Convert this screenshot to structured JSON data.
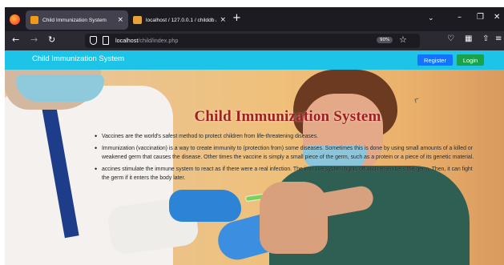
{
  "browser": {
    "tabs": [
      {
        "title": "Child Immunization System",
        "active": true
      },
      {
        "title": "localhost / 127.0.0.1 / childdb / ...",
        "active": false
      }
    ],
    "new_tab_symbol": "+",
    "close_symbol": "×",
    "url_host": "localhost",
    "url_path": "/child/index.php",
    "zoom": "90%",
    "icons": [
      "back-arrow",
      "forward-arrow",
      "reload",
      "shield",
      "page",
      "star",
      "pocket",
      "extensions",
      "share",
      "menu"
    ]
  },
  "site": {
    "brand": "Child Immunization System",
    "register_label": "Register",
    "login_label": "Login",
    "accent_colors": {
      "navbar": "#1ec4e8",
      "register": "#1373ff",
      "login": "#18a34a",
      "title": "#a21f1f"
    }
  },
  "hero": {
    "title": "Child Immunization System",
    "bullets": [
      "Vaccines are the world's safest method to protect children from life-threatening diseases.",
      "Immunization (vaccination) is a way to create immunity to (protection from) some diseases. Sometimes this is done by using small amounts of a killed or weakened germ that causes the disease. Other times the vaccine is simply a small piece of the germ, such as a protein or a piece of its genetic material.",
      "accines stimulate the immune system to react as if there were a real infection. The immune system fights off and remembers the germ. Then, it can fight the germ if it enters the body later."
    ]
  }
}
